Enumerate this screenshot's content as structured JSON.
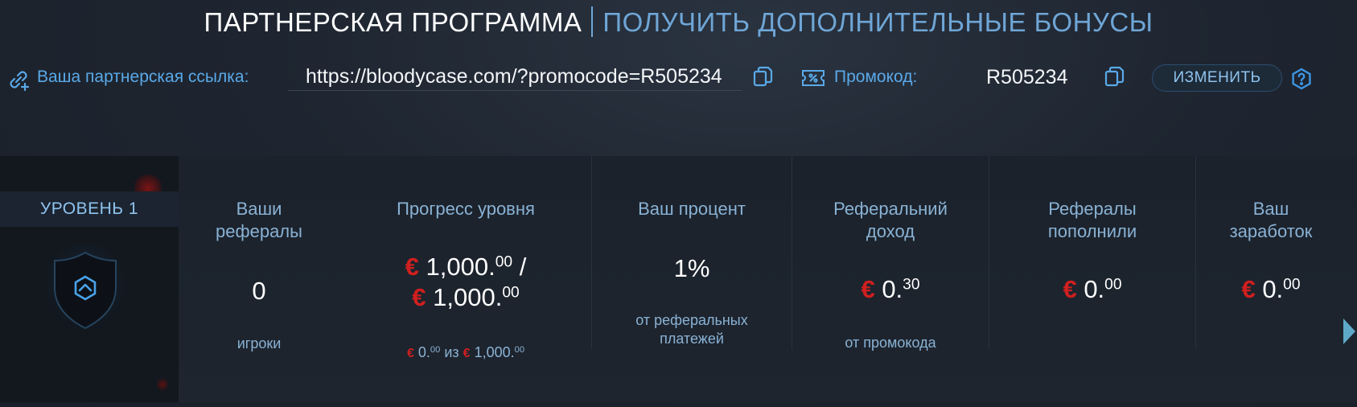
{
  "header": {
    "title": "ПАРТНЕРСКАЯ ПРОГРАММА",
    "bonus_link": "ПОЛУЧИТЬ ДОПОЛНИТЕЛЬНЫЕ БОНУСЫ"
  },
  "referral": {
    "label": "Ваша партнерская ссылка:",
    "url": "https://bloodycase.com/?promocode=R505234",
    "copy_icon": "copy-icon"
  },
  "promo": {
    "label": "Промокод:",
    "code": "R505234",
    "change_button": "ИЗМЕНИТЬ",
    "help_icon": "question-icon"
  },
  "level": {
    "label": "УРОВЕНЬ 1",
    "icon": "shield-chevron-icon"
  },
  "stats": {
    "referrals": {
      "title": "Ваши рефералы",
      "value": "0",
      "sub": "игроки"
    },
    "progress": {
      "title": "Прогресс уровня",
      "current_int": "1,000.",
      "current_dec": "00",
      "slash": " /",
      "target_int": "1,000.",
      "target_dec": "00",
      "small_current_int": "0.",
      "small_current_dec": "00",
      "small_of": "из",
      "small_target_int": "1,000.",
      "small_target_dec": "00"
    },
    "percent": {
      "title": "Ваш процент",
      "value": "1%",
      "sub": "от реферальных платежей"
    },
    "income": {
      "title": "Реферальний доход",
      "value_int": "0.",
      "value_dec": "30",
      "sub": "от промокода"
    },
    "deposited": {
      "title": "Рефералы пополнили",
      "value_int": "0.",
      "value_dec": "00"
    },
    "earnings": {
      "title": "Ваш заработок",
      "value_int": "0.",
      "value_dec": "00"
    }
  },
  "currency_symbol": "€",
  "colors": {
    "accent": "#5aa9e8",
    "currency": "#d01f1f",
    "background": "#1e2530"
  }
}
